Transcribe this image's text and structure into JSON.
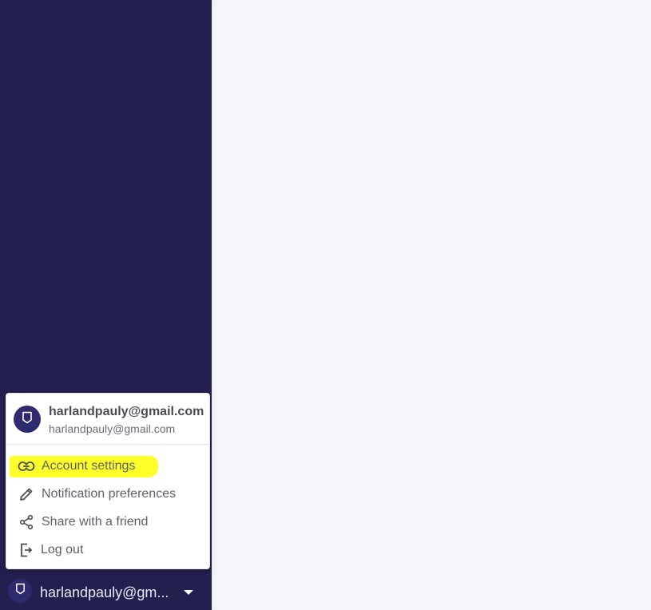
{
  "sidebar": {
    "footer": {
      "display_name": "harlandpauly@gm...",
      "avatar_icon": "shield-icon",
      "dropdown_icon": "caret-down-icon"
    }
  },
  "user_menu": {
    "header": {
      "name": "harlandpauly@gmail.com",
      "email": "harlandpauly@gmail.com",
      "avatar_icon": "shield-icon"
    },
    "items": [
      {
        "label": "Account settings",
        "icon": "link-icon",
        "highlighted": true
      },
      {
        "label": "Notification preferences",
        "icon": "pencil-icon",
        "highlighted": false
      },
      {
        "label": "Share with a friend",
        "icon": "share-icon",
        "highlighted": false
      },
      {
        "label": "Log out",
        "icon": "logout-icon",
        "highlighted": false
      }
    ]
  },
  "colors": {
    "sidebar_bg": "#231f4f",
    "main_bg": "#f5f6fa",
    "avatar_bg": "#2e2a6e",
    "highlight": "#ffff2a"
  }
}
